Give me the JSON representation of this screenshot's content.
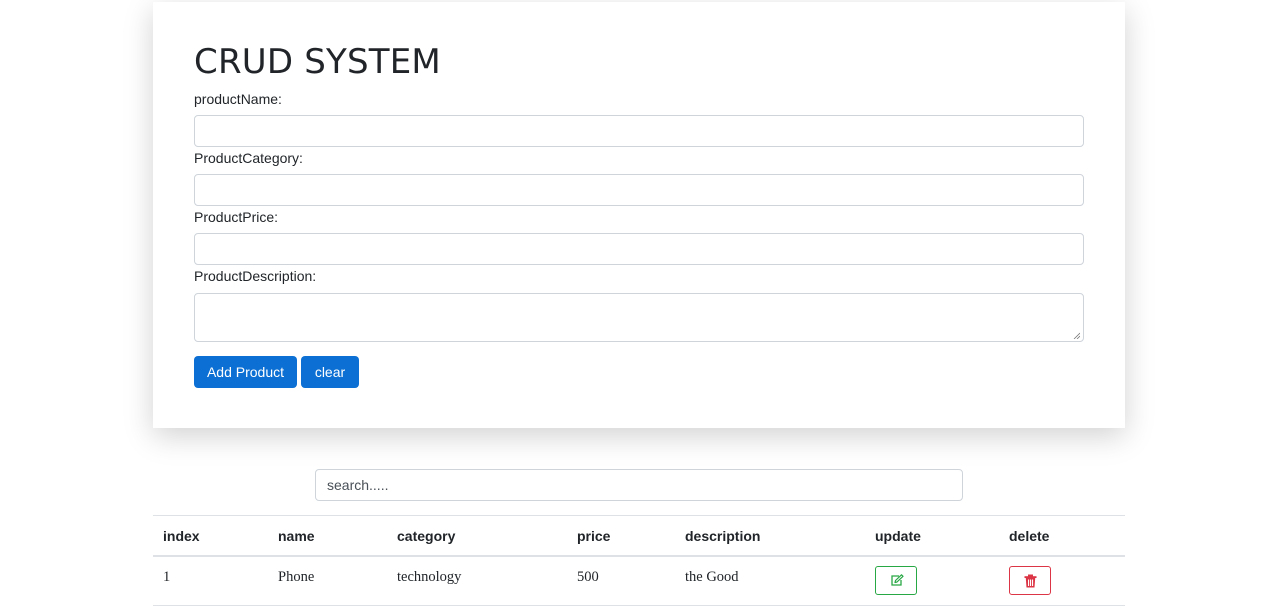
{
  "form": {
    "title": "CRUD SYSTEM",
    "fields": [
      {
        "label": "productName:",
        "value": ""
      },
      {
        "label": "ProductCategory:",
        "value": ""
      },
      {
        "label": "ProductPrice:",
        "value": ""
      },
      {
        "label": "ProductDescription:",
        "value": ""
      }
    ],
    "add_button": "Add Product",
    "clear_button": "clear"
  },
  "search": {
    "placeholder": "search....."
  },
  "table": {
    "headers": [
      "index",
      "name",
      "category",
      "price",
      "description",
      "update",
      "delete"
    ],
    "rows": [
      {
        "index": "1",
        "name": "Phone",
        "category": "technology",
        "price": "500",
        "description": "the Good",
        "update_icon": "edit-icon",
        "delete_icon": "trash-icon"
      }
    ]
  },
  "colors": {
    "primary": "#0b6fd3",
    "success": "#28a745",
    "danger": "#dc3545",
    "border": "#ced4da"
  }
}
